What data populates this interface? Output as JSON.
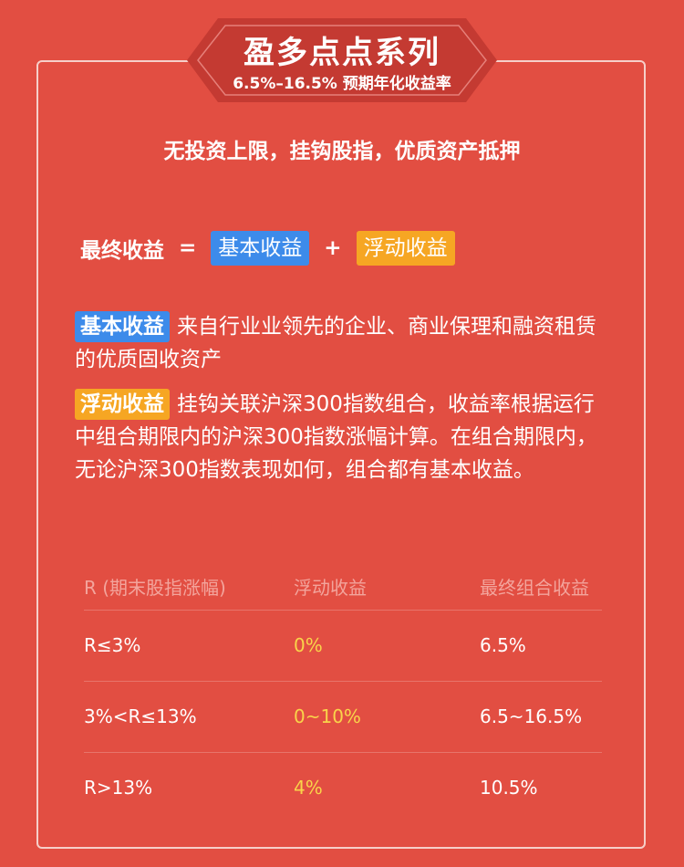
{
  "badge": {
    "title": "盈多点点系列",
    "subtitle": "6.5%–16.5% 预期年化收益率"
  },
  "tagline": "无投资上限，挂钩股指，优质资产抵押",
  "formula": {
    "final": "最终收益",
    "equals": "=",
    "base": "基本收益",
    "plus": "+",
    "floating": "浮动收益"
  },
  "descriptions": {
    "base_label": "基本收益",
    "base_text": "来自行业业领先的企业、商业保理和融资租赁的优质固收资产",
    "floating_label": "浮动收益",
    "floating_text": "挂钩关联沪深300指数组合，收益率根据运行中组合期限内的沪深300指数涨幅计算。在组合期限内，无论沪深300指数表现如何，组合都有基本收益。"
  },
  "table": {
    "headers": [
      "R (期末股指涨幅)",
      "浮动收益",
      "最终组合收益"
    ],
    "rows": [
      [
        "R≤3%",
        "0%",
        "6.5%"
      ],
      [
        "3%<R≤13%",
        "0~10%",
        "6.5~16.5%"
      ],
      [
        "R>13%",
        "4%",
        "10.5%"
      ]
    ]
  },
  "colors": {
    "background": "#e24e42",
    "badge": "#c43a32",
    "blue_chip": "#3d8bea",
    "orange_chip": "#f6a623",
    "floating_value": "#f9d44a",
    "table_header": "#f3a49c"
  }
}
